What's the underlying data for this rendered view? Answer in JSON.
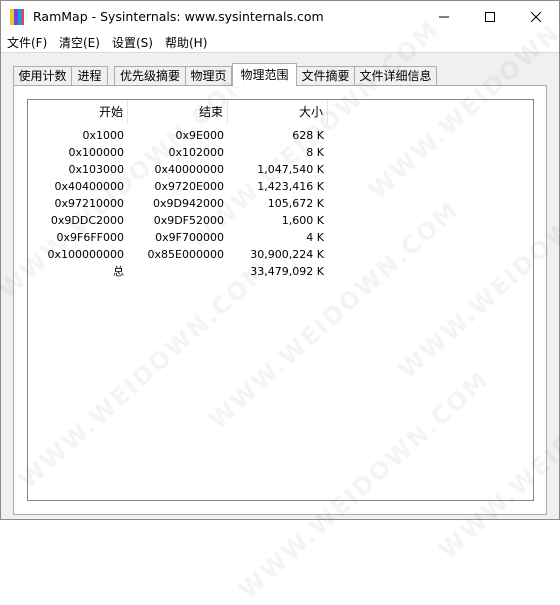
{
  "window": {
    "title": "RamMap - Sysinternals: www.sysinternals.com"
  },
  "titlebar_icons": [
    "minimize-icon",
    "maximize-icon",
    "close-icon"
  ],
  "menu": [
    {
      "label": "文件(F)"
    },
    {
      "label": "清空(E)"
    },
    {
      "label": "设置(S)"
    },
    {
      "label": "帮助(H)"
    }
  ],
  "tabs": [
    {
      "label": "使用计数"
    },
    {
      "label": "进程"
    },
    {
      "label": "优先级摘要"
    },
    {
      "label": "物理页"
    },
    {
      "label": "物理范围",
      "active": true
    },
    {
      "label": "文件摘要"
    },
    {
      "label": "文件详细信息"
    }
  ],
  "table": {
    "columns": [
      "开始",
      "结束",
      "大小"
    ],
    "rows": [
      [
        "0x1000",
        "0x9E000",
        "628 K"
      ],
      [
        "0x100000",
        "0x102000",
        "8 K"
      ],
      [
        "0x103000",
        "0x40000000",
        "1,047,540 K"
      ],
      [
        "0x40400000",
        "0x9720E000",
        "1,423,416 K"
      ],
      [
        "0x97210000",
        "0x9D942000",
        "105,672 K"
      ],
      [
        "0x9DDC2000",
        "0x9DF52000",
        "1,600 K"
      ],
      [
        "0x9F6FF000",
        "0x9F700000",
        "4 K"
      ],
      [
        "0x100000000",
        "0x85E000000",
        "30,900,224 K"
      ]
    ],
    "total": {
      "label": "总",
      "end": "",
      "size": "33,479,092 K"
    }
  },
  "watermark": "WWW.WEIDOWN.COM",
  "colors": {
    "window_bg": "#f0f0f0",
    "panel_bg": "#ffffff",
    "border": "#adadad"
  }
}
